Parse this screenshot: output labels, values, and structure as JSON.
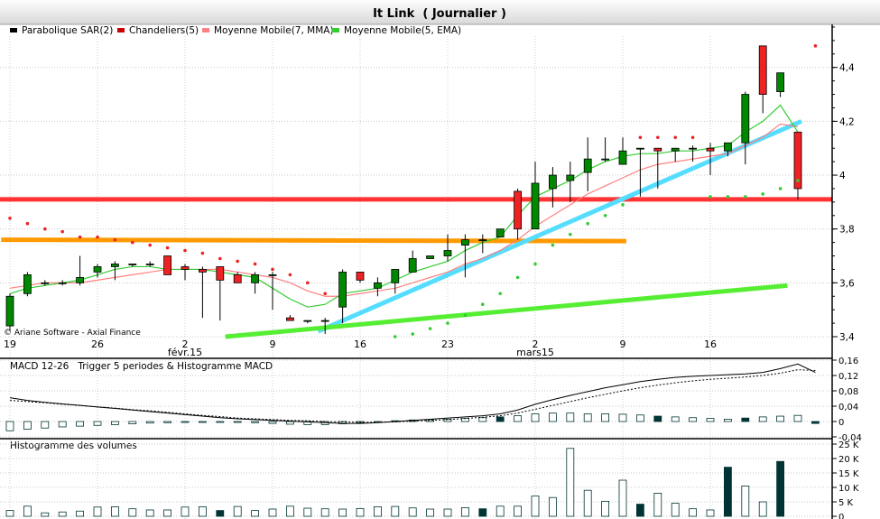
{
  "window": {
    "title": "It Link  ( Journalier )"
  },
  "legend": [
    {
      "label": "Parabolique SAR(2)",
      "color": "#000000"
    },
    {
      "label": "Chandeliers(5)",
      "color": "#cc0000"
    },
    {
      "label": "Moyenne Mobile(7, MMA)",
      "color": "#ff8080"
    },
    {
      "label": "Moyenne Mobile(5, EMA)",
      "color": "#33cc33"
    }
  ],
  "copyright": "© Ariane Software - Axial Finance",
  "panels": {
    "macd_title": "MACD 12-26   Trigger 5 periodes & Histogramme MACD",
    "volume_title": "Histogramme des volumes"
  },
  "colors": {
    "up": "#008800",
    "down": "#ee2222",
    "sar": "#ee2222",
    "sar_up": "#33cc33",
    "mma": "#ff8080",
    "ema": "#33cc33",
    "red_line": "#ff3333",
    "orange_line": "#ff9900",
    "cyan_line": "#55ddff",
    "green_line": "#55ee33",
    "vol_dark": "#003333"
  },
  "chart_data": {
    "type": "candlestick",
    "title": "It Link  ( Journalier )",
    "x_ticks": [
      {
        "i": 0,
        "label": "19"
      },
      {
        "i": 5,
        "label": "26"
      },
      {
        "i": 10,
        "label": "2",
        "sub": "févr.15"
      },
      {
        "i": 15,
        "label": "9"
      },
      {
        "i": 20,
        "label": "16"
      },
      {
        "i": 25,
        "label": "23"
      },
      {
        "i": 30,
        "label": "2",
        "sub": "mars15"
      },
      {
        "i": 35,
        "label": "9"
      },
      {
        "i": 40,
        "label": "16"
      }
    ],
    "price": {
      "ylim": [
        3.4,
        4.56
      ],
      "y_ticks": [
        3.4,
        3.6,
        3.8,
        4.0,
        4.2,
        4.4
      ],
      "y_tick_labels": [
        "3,4",
        "3,6",
        "3,8",
        "4",
        "4,2",
        "4,4"
      ],
      "candles": [
        {
          "o": 3.44,
          "h": 3.56,
          "l": 3.42,
          "c": 3.55
        },
        {
          "o": 3.56,
          "h": 3.64,
          "l": 3.55,
          "c": 3.63
        },
        {
          "o": 3.6,
          "h": 3.61,
          "l": 3.59,
          "c": 3.6
        },
        {
          "o": 3.6,
          "h": 3.61,
          "l": 3.59,
          "c": 3.6
        },
        {
          "o": 3.6,
          "h": 3.7,
          "l": 3.59,
          "c": 3.62
        },
        {
          "o": 3.64,
          "h": 3.67,
          "l": 3.62,
          "c": 3.66
        },
        {
          "o": 3.66,
          "h": 3.68,
          "l": 3.61,
          "c": 3.67
        },
        {
          "o": 3.67,
          "h": 3.67,
          "l": 3.66,
          "c": 3.67
        },
        {
          "o": 3.67,
          "h": 3.68,
          "l": 3.66,
          "c": 3.67
        },
        {
          "o": 3.7,
          "h": 3.7,
          "l": 3.63,
          "c": 3.63
        },
        {
          "o": 3.66,
          "h": 3.67,
          "l": 3.61,
          "c": 3.65
        },
        {
          "o": 3.65,
          "h": 3.66,
          "l": 3.47,
          "c": 3.64
        },
        {
          "o": 3.66,
          "h": 3.66,
          "l": 3.46,
          "c": 3.61
        },
        {
          "o": 3.63,
          "h": 3.64,
          "l": 3.6,
          "c": 3.6
        },
        {
          "o": 3.6,
          "h": 3.64,
          "l": 3.56,
          "c": 3.63
        },
        {
          "o": 3.63,
          "h": 3.64,
          "l": 3.5,
          "c": 3.63
        },
        {
          "o": 3.47,
          "h": 3.48,
          "l": 3.46,
          "c": 3.46
        },
        {
          "o": 3.46,
          "h": 3.46,
          "l": 3.45,
          "c": 3.46
        },
        {
          "o": 3.46,
          "h": 3.47,
          "l": 3.41,
          "c": 3.46
        },
        {
          "o": 3.51,
          "h": 3.65,
          "l": 3.45,
          "c": 3.64
        },
        {
          "o": 3.64,
          "h": 3.64,
          "l": 3.6,
          "c": 3.61
        },
        {
          "o": 3.58,
          "h": 3.62,
          "l": 3.55,
          "c": 3.6
        },
        {
          "o": 3.6,
          "h": 3.65,
          "l": 3.56,
          "c": 3.65
        },
        {
          "o": 3.64,
          "h": 3.72,
          "l": 3.64,
          "c": 3.69
        },
        {
          "o": 3.69,
          "h": 3.7,
          "l": 3.69,
          "c": 3.7
        },
        {
          "o": 3.7,
          "h": 3.78,
          "l": 3.68,
          "c": 3.72
        },
        {
          "o": 3.74,
          "h": 3.78,
          "l": 3.62,
          "c": 3.76
        },
        {
          "o": 3.76,
          "h": 3.78,
          "l": 3.71,
          "c": 3.76
        },
        {
          "o": 3.77,
          "h": 3.8,
          "l": 3.77,
          "c": 3.8
        },
        {
          "o": 3.94,
          "h": 3.95,
          "l": 3.76,
          "c": 3.8
        },
        {
          "o": 3.8,
          "h": 4.05,
          "l": 3.8,
          "c": 3.97
        },
        {
          "o": 3.95,
          "h": 4.03,
          "l": 3.88,
          "c": 4.0
        },
        {
          "o": 3.98,
          "h": 4.05,
          "l": 3.9,
          "c": 4.0
        },
        {
          "o": 4.01,
          "h": 4.14,
          "l": 3.94,
          "c": 4.06
        },
        {
          "o": 4.06,
          "h": 4.14,
          "l": 4.05,
          "c": 4.06
        },
        {
          "o": 4.04,
          "h": 4.14,
          "l": 4.04,
          "c": 4.09
        },
        {
          "o": 4.1,
          "h": 4.1,
          "l": 3.92,
          "c": 4.1
        },
        {
          "o": 4.1,
          "h": 4.1,
          "l": 3.95,
          "c": 4.09
        },
        {
          "o": 4.09,
          "h": 4.1,
          "l": 4.05,
          "c": 4.1
        },
        {
          "o": 4.1,
          "h": 4.11,
          "l": 4.05,
          "c": 4.1
        },
        {
          "o": 4.1,
          "h": 4.12,
          "l": 4.0,
          "c": 4.09
        },
        {
          "o": 4.09,
          "h": 4.12,
          "l": 4.07,
          "c": 4.12
        },
        {
          "o": 4.12,
          "h": 4.31,
          "l": 4.04,
          "c": 4.3
        },
        {
          "o": 4.48,
          "h": 4.48,
          "l": 4.23,
          "c": 4.3
        },
        {
          "o": 4.31,
          "h": 4.38,
          "l": 4.29,
          "c": 4.38
        },
        {
          "o": 4.16,
          "h": 4.16,
          "l": 3.91,
          "c": 3.95
        }
      ],
      "sar": [
        {
          "v": 3.84,
          "d": "down"
        },
        {
          "v": 3.82,
          "d": "down"
        },
        {
          "v": 3.8,
          "d": "down"
        },
        {
          "v": 3.79,
          "d": "down"
        },
        {
          "v": 3.77,
          "d": "down"
        },
        {
          "v": 3.77,
          "d": "down"
        },
        {
          "v": 3.76,
          "d": "down"
        },
        {
          "v": 3.75,
          "d": "down"
        },
        {
          "v": 3.74,
          "d": "down"
        },
        {
          "v": 3.73,
          "d": "down"
        },
        {
          "v": 3.72,
          "d": "down"
        },
        {
          "v": 3.71,
          "d": "down"
        },
        {
          "v": 3.69,
          "d": "down"
        },
        {
          "v": 3.68,
          "d": "down"
        },
        {
          "v": 3.67,
          "d": "down"
        },
        {
          "v": 3.65,
          "d": "down"
        },
        {
          "v": 3.63,
          "d": "down"
        },
        {
          "v": 3.6,
          "d": "down"
        },
        {
          "v": 3.56,
          "d": "down"
        },
        {
          "v": null,
          "d": "down"
        },
        {
          "v": null,
          "d": "down"
        },
        {
          "v": null,
          "d": "down"
        },
        {
          "v": 3.4,
          "d": "up"
        },
        {
          "v": 3.41,
          "d": "up"
        },
        {
          "v": 3.43,
          "d": "up"
        },
        {
          "v": 3.45,
          "d": "up"
        },
        {
          "v": 3.48,
          "d": "up"
        },
        {
          "v": 3.52,
          "d": "up"
        },
        {
          "v": 3.56,
          "d": "up"
        },
        {
          "v": 3.62,
          "d": "up"
        },
        {
          "v": 3.67,
          "d": "up"
        },
        {
          "v": 3.74,
          "d": "up"
        },
        {
          "v": 3.78,
          "d": "up"
        },
        {
          "v": 3.82,
          "d": "up"
        },
        {
          "v": 3.85,
          "d": "up"
        },
        {
          "v": 3.89,
          "d": "up"
        },
        {
          "v": 4.14,
          "d": "down"
        },
        {
          "v": 4.14,
          "d": "down"
        },
        {
          "v": 4.14,
          "d": "down"
        },
        {
          "v": 4.14,
          "d": "down"
        },
        {
          "v": 3.92,
          "d": "up"
        },
        {
          "v": 3.92,
          "d": "up"
        },
        {
          "v": 3.92,
          "d": "up"
        },
        {
          "v": 3.93,
          "d": "up"
        },
        {
          "v": 3.95,
          "d": "up"
        },
        {
          "v": 3.98,
          "d": "up"
        },
        {
          "v": 4.48,
          "d": "down"
        }
      ],
      "mma": [
        3.58,
        3.59,
        3.6,
        3.6,
        3.6,
        3.61,
        3.62,
        3.63,
        3.64,
        3.65,
        3.65,
        3.65,
        3.65,
        3.64,
        3.63,
        3.62,
        3.6,
        3.57,
        3.55,
        3.55,
        3.56,
        3.57,
        3.58,
        3.6,
        3.62,
        3.64,
        3.67,
        3.69,
        3.72,
        3.76,
        3.81,
        3.85,
        3.89,
        3.93,
        3.96,
        3.99,
        4.02,
        4.04,
        4.05,
        4.06,
        4.07,
        4.08,
        4.11,
        4.14,
        4.19,
        4.18
      ],
      "ema": [
        3.56,
        3.58,
        3.59,
        3.6,
        3.61,
        3.63,
        3.65,
        3.66,
        3.66,
        3.65,
        3.65,
        3.65,
        3.64,
        3.63,
        3.62,
        3.58,
        3.54,
        3.51,
        3.52,
        3.56,
        3.57,
        3.58,
        3.61,
        3.64,
        3.66,
        3.68,
        3.72,
        3.75,
        3.77,
        3.85,
        3.92,
        3.95,
        3.98,
        4.02,
        4.05,
        4.07,
        4.08,
        4.08,
        4.09,
        4.09,
        4.1,
        4.11,
        4.16,
        4.2,
        4.26,
        4.16
      ],
      "h_lines": [
        {
          "value": 3.91,
          "color": "red_line"
        }
      ],
      "lines": [
        {
          "x0": -0.5,
          "y0": 3.76,
          "x1": 35.2,
          "y1": 3.755,
          "color": "orange_line"
        },
        {
          "x0": 17.6,
          "y0": 3.42,
          "x1": 45.2,
          "y1": 4.2,
          "color": "cyan_line"
        },
        {
          "x0": 12.3,
          "y0": 3.4,
          "x1": 44.4,
          "y1": 3.59,
          "color": "green_line"
        }
      ]
    },
    "macd": {
      "ylim": [
        -0.04,
        0.16
      ],
      "y_ticks": [
        -0.04,
        0,
        0.04,
        0.08,
        0.12,
        0.16
      ],
      "y_tick_labels": [
        "-0,04",
        "0",
        "0,04",
        "0,08",
        "0,12",
        "0,16"
      ],
      "macd": [
        0.062,
        0.055,
        0.05,
        0.046,
        0.042,
        0.038,
        0.034,
        0.03,
        0.026,
        0.022,
        0.018,
        0.014,
        0.01,
        0.007,
        0.005,
        0.003,
        0.001,
        -0.001,
        -0.003,
        -0.005,
        -0.005,
        -0.003,
        0,
        0.003,
        0.006,
        0.009,
        0.012,
        0.015,
        0.02,
        0.03,
        0.045,
        0.057,
        0.068,
        0.078,
        0.088,
        0.096,
        0.104,
        0.11,
        0.115,
        0.118,
        0.12,
        0.122,
        0.124,
        0.128,
        0.138,
        0.15,
        0.128
      ],
      "trigger": [
        0.055,
        0.052,
        0.049,
        0.045,
        0.042,
        0.038,
        0.035,
        0.031,
        0.028,
        0.024,
        0.02,
        0.016,
        0.013,
        0.009,
        0.007,
        0.005,
        0.003,
        0.002,
        0,
        -0.001,
        -0.002,
        -0.002,
        -0.001,
        0.001,
        0.003,
        0.005,
        0.008,
        0.011,
        0.015,
        0.022,
        0.032,
        0.042,
        0.052,
        0.062,
        0.071,
        0.08,
        0.088,
        0.095,
        0.101,
        0.106,
        0.11,
        0.113,
        0.116,
        0.12,
        0.126,
        0.135,
        0.133
      ],
      "hist": [
        -0.024,
        -0.02,
        -0.017,
        -0.014,
        -0.012,
        -0.01,
        -0.008,
        -0.006,
        -0.004,
        -0.003,
        -0.002,
        -0.002,
        -0.002,
        -0.002,
        -0.003,
        -0.005,
        -0.007,
        -0.008,
        -0.008,
        -0.006,
        -0.003,
        -0.001,
        0.002,
        0.004,
        0.005,
        0.006,
        0.008,
        0.01,
        0.012,
        0.015,
        0.02,
        0.022,
        0.022,
        0.02,
        0.02,
        0.019,
        0.017,
        0.014,
        0.012,
        0.01,
        0.008,
        0.006,
        0.009,
        0.012,
        0.014,
        0.016,
        -0.005
      ]
    },
    "volume": {
      "ylim": [
        0,
        25000
      ],
      "y_ticks": [
        0,
        5000,
        10000,
        15000,
        20000,
        25000
      ],
      "y_tick_labels": [
        "0",
        "5 K",
        "10 K",
        "15 K",
        "20 K",
        "25 K"
      ],
      "values": [
        2000,
        3500,
        1200,
        1500,
        1800,
        3200,
        3300,
        2600,
        2200,
        2200,
        3200,
        3300,
        2000,
        3400,
        2000,
        2500,
        3500,
        2800,
        2600,
        2500,
        2700,
        3300,
        3400,
        2900,
        2500,
        2500,
        3000,
        2600,
        3500,
        3500,
        7000,
        6500,
        23500,
        9000,
        5200,
        12500,
        4200,
        8000,
        4500,
        2600,
        2200,
        17000,
        10500,
        5000,
        19000
      ],
      "dark": [
        false,
        false,
        false,
        false,
        false,
        false,
        false,
        false,
        false,
        false,
        false,
        false,
        true,
        false,
        false,
        false,
        false,
        false,
        false,
        false,
        false,
        false,
        false,
        false,
        false,
        false,
        false,
        true,
        false,
        false,
        false,
        false,
        false,
        false,
        false,
        false,
        true,
        false,
        false,
        false,
        false,
        true,
        false,
        false,
        true
      ]
    }
  }
}
